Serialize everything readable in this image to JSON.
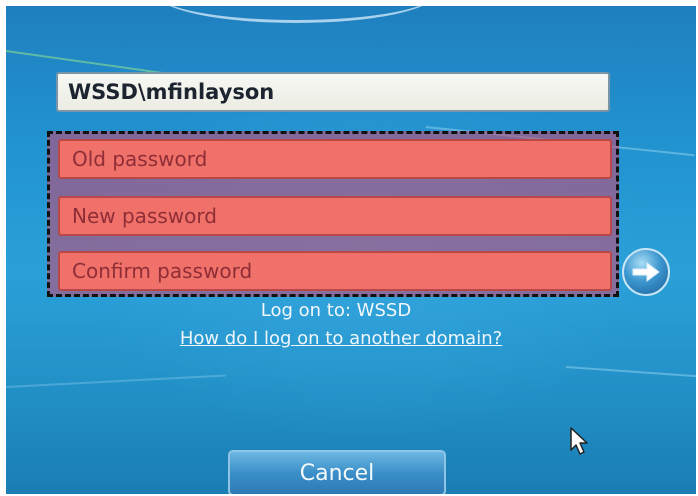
{
  "username": {
    "value": "WSSD\\mfinlayson"
  },
  "password_fields": {
    "old_placeholder": "Old password",
    "new_placeholder": "New password",
    "confirm_placeholder": "Confirm password"
  },
  "logon": {
    "label": "Log on to: WSSD",
    "other_domain_link": "How do I log on to another domain?"
  },
  "buttons": {
    "cancel_label": "Cancel",
    "submit_icon": "right-arrow-icon"
  },
  "colors": {
    "highlight": "#f0706a",
    "highlight_border": "#111111",
    "background": "#2193cf"
  }
}
